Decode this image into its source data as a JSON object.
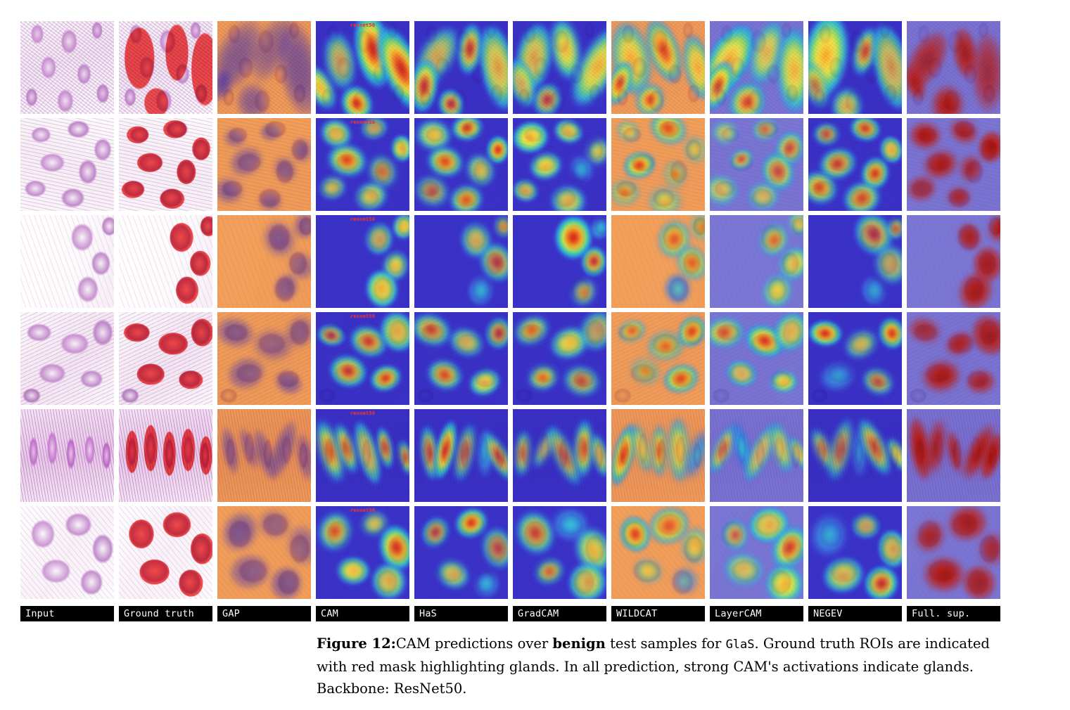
{
  "figure": {
    "number_label": "Figure 12:",
    "caption_part1": "CAM predictions over ",
    "caption_keyword": "benign",
    "caption_part2": " test samples for ",
    "caption_dataset": "GlaS",
    "caption_part3": ". Ground truth ROIs are indicated with red mask highlighting glands. In all prediction, strong CAM's activations indicate glands. Backbone: ResNet50.",
    "dataset": "GlaS",
    "backbone": "ResNet50",
    "sample_type": "benign",
    "rows": 6,
    "columns": 10,
    "inline_annotation": "resnet50",
    "annotation_color": "#e8201c",
    "mask_color": "#f43c3c",
    "label_bar_bg": "#000000",
    "label_bar_fg": "#ffffff"
  },
  "columns": [
    {
      "index": 0,
      "label": "Input",
      "kind": "input"
    },
    {
      "index": 1,
      "label": "Ground truth",
      "kind": "groundtruth"
    },
    {
      "index": 2,
      "label": "GAP",
      "kind": "cam"
    },
    {
      "index": 3,
      "label": "CAM",
      "kind": "cam"
    },
    {
      "index": 4,
      "label": "HaS",
      "kind": "cam"
    },
    {
      "index": 5,
      "label": "GradCAM",
      "kind": "cam"
    },
    {
      "index": 6,
      "label": "WILDCAT",
      "kind": "cam"
    },
    {
      "index": 7,
      "label": "LayerCAM",
      "kind": "cam"
    },
    {
      "index": 8,
      "label": "NEGEV",
      "kind": "cam"
    },
    {
      "index": 9,
      "label": "Full. sup.",
      "kind": "fullsup"
    }
  ],
  "rows": [
    {
      "index": 0,
      "tissue": "tex-a",
      "mask": "gt-a",
      "note": "elongated crypts, magenta"
    },
    {
      "index": 1,
      "tissue": "tex-b",
      "mask": "gt-b",
      "note": "round glands cluster"
    },
    {
      "index": 2,
      "tissue": "tex-c",
      "mask": "gt-c",
      "note": "sparse pale field, glands at right"
    },
    {
      "index": 3,
      "tissue": "tex-d",
      "mask": "gt-d",
      "note": "large oval glands"
    },
    {
      "index": 4,
      "tissue": "tex-e",
      "mask": "gt-e",
      "note": "dense vertical villi"
    },
    {
      "index": 5,
      "tissue": "tex-f",
      "mask": "gt-f",
      "note": "open pale glands, thin stroma"
    }
  ]
}
